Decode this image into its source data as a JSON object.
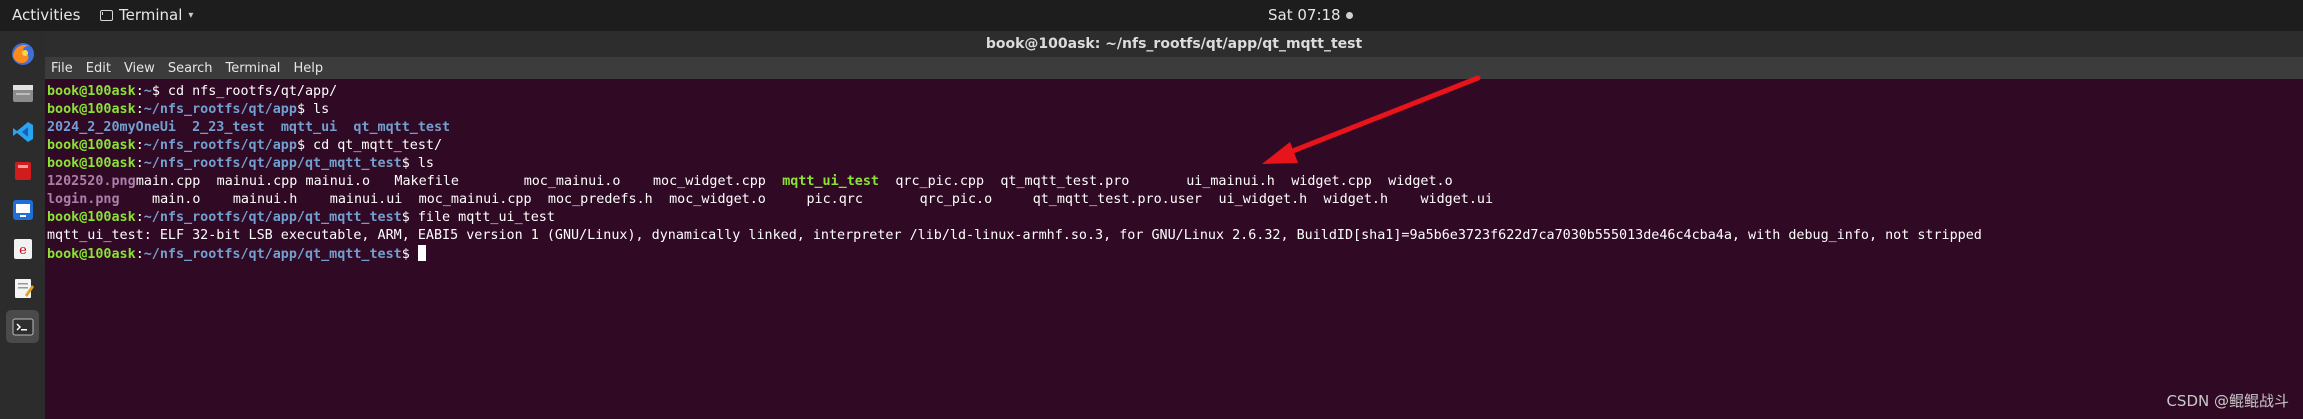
{
  "topbar": {
    "activities": "Activities",
    "app_name": "Terminal",
    "app_caret": "▾",
    "clock": "Sat 07:18"
  },
  "window": {
    "title": "book@100ask: ~/nfs_rootfs/qt/app/qt_mqtt_test"
  },
  "menu": [
    "File",
    "Edit",
    "View",
    "Search",
    "Terminal",
    "Help"
  ],
  "terminal": {
    "lines": [
      [
        {
          "t": "book@100ask",
          "c": "u"
        },
        {
          "t": ":"
        },
        {
          "t": "~",
          "c": "p"
        },
        {
          "t": "$ cd nfs_rootfs/qt/app/"
        }
      ],
      [
        {
          "t": "book@100ask",
          "c": "u"
        },
        {
          "t": ":"
        },
        {
          "t": "~/nfs_rootfs/qt/app",
          "c": "p"
        },
        {
          "t": "$ ls"
        }
      ],
      [
        {
          "t": "2024_2_20myOneUi",
          "c": "d"
        },
        {
          "t": "  "
        },
        {
          "t": "2_23_test",
          "c": "d"
        },
        {
          "t": "  "
        },
        {
          "t": "mqtt_ui",
          "c": "d"
        },
        {
          "t": "  "
        },
        {
          "t": "qt_mqtt_test",
          "c": "d"
        }
      ],
      [
        {
          "t": "book@100ask",
          "c": "u"
        },
        {
          "t": ":"
        },
        {
          "t": "~/nfs_rootfs/qt/app",
          "c": "p"
        },
        {
          "t": "$ cd qt_mqtt_test/"
        }
      ],
      [
        {
          "t": "book@100ask",
          "c": "u"
        },
        {
          "t": ":"
        },
        {
          "t": "~/nfs_rootfs/qt/app/qt_mqtt_test",
          "c": "p"
        },
        {
          "t": "$ ls"
        }
      ],
      [
        {
          "t": "1202520.png",
          "c": "img",
          "w": 11
        },
        {
          "t": "main.cpp",
          "w": 10
        },
        {
          "t": "mainui.cpp",
          "w": 11
        },
        {
          "t": "mainui.o",
          "w": 11
        },
        {
          "t": "Makefile",
          "w": 16
        },
        {
          "t": "moc_mainui.o",
          "w": 16
        },
        {
          "t": "moc_widget.cpp",
          "w": 16
        },
        {
          "t": "mqtt_ui_test",
          "c": "exe",
          "w": 14
        },
        {
          "t": "qrc_pic.cpp",
          "w": 13
        },
        {
          "t": "qt_mqtt_test.pro",
          "w": 23
        },
        {
          "t": "ui_mainui.h",
          "w": 13
        },
        {
          "t": "widget.cpp",
          "w": 12
        },
        {
          "t": "widget.o"
        }
      ],
      [
        {
          "t": "login.png",
          "c": "img",
          "w": 13
        },
        {
          "t": "main.o",
          "w": 10
        },
        {
          "t": "mainui.h",
          "w": 12
        },
        {
          "t": "mainui.ui",
          "w": 11
        },
        {
          "t": "moc_mainui.cpp",
          "w": 16
        },
        {
          "t": "moc_predefs.h",
          "w": 15
        },
        {
          "t": "moc_widget.o",
          "w": 17
        },
        {
          "t": "pic.qrc",
          "w": 14
        },
        {
          "t": "qrc_pic.o",
          "w": 14
        },
        {
          "t": "qt_mqtt_test.pro.user",
          "w": 23
        },
        {
          "t": "ui_widget.h",
          "w": 13
        },
        {
          "t": "widget.h",
          "w": 12
        },
        {
          "t": "widget.ui"
        }
      ],
      [
        {
          "t": "book@100ask",
          "c": "u"
        },
        {
          "t": ":"
        },
        {
          "t": "~/nfs_rootfs/qt/app/qt_mqtt_test",
          "c": "p"
        },
        {
          "t": "$ file mqtt_ui_test"
        }
      ],
      [
        {
          "t": "mqtt_ui_test: ELF 32-bit LSB executable, ARM, EABI5 version 1 (GNU/Linux), dynamically linked, interpreter /lib/ld-linux-armhf.so.3, for GNU/Linux 2.6.32, BuildID[sha1]=9a5b6e3723f622d7ca7030b555013de46c4cba4a, with debug_info, not stripped"
        }
      ],
      [
        {
          "t": "book@100ask",
          "c": "u"
        },
        {
          "t": ":"
        },
        {
          "t": "~/nfs_rootfs/qt/app/qt_mqtt_test",
          "c": "p"
        },
        {
          "t": "$ "
        },
        {
          "cursor": true
        }
      ]
    ]
  },
  "dock": [
    {
      "icon": "firefox-icon"
    },
    {
      "icon": "files-icon"
    },
    {
      "icon": "vscode-icon"
    },
    {
      "icon": "red-app-icon"
    },
    {
      "icon": "remote-desktop-icon"
    },
    {
      "icon": "red-e-app-icon"
    },
    {
      "icon": "text-editor-icon"
    },
    {
      "icon": "terminal-icon",
      "active": true
    }
  ],
  "watermark": "CSDN @鲲鲲战斗",
  "colors": {
    "terminal_bg": "#300a24",
    "prompt_user": "#8ae234",
    "prompt_path": "#729fcf",
    "image_file": "#ad7fa8",
    "arrow": "#e8141c"
  }
}
